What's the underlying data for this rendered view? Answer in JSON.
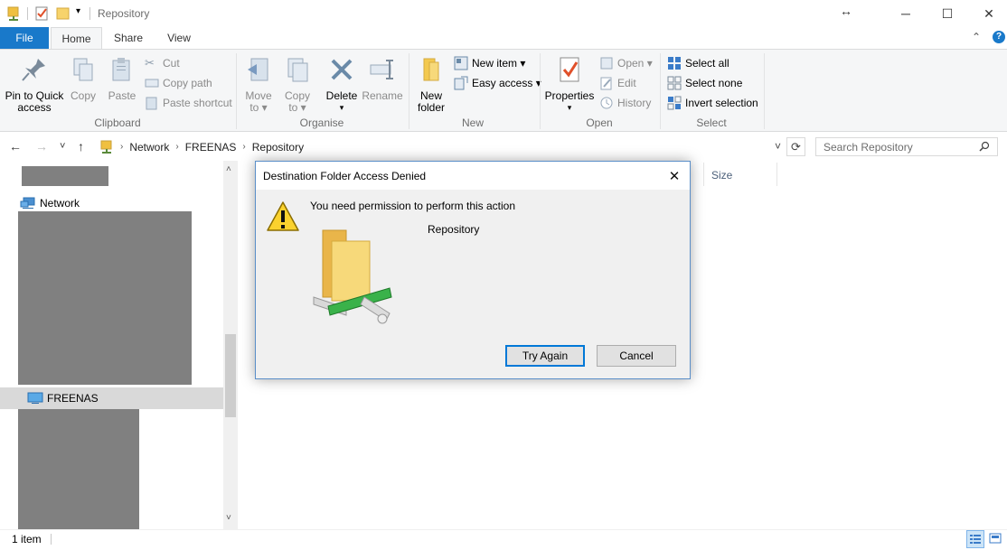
{
  "window": {
    "title": "Repository",
    "resize_glyph": "↔",
    "minimize": "─",
    "maximize": "☐",
    "close": "✕"
  },
  "ribbon_tabs": {
    "file": "File",
    "home": "Home",
    "share": "Share",
    "view": "View",
    "collapse": "⌃",
    "help": "?"
  },
  "ribbon": {
    "clipboard": {
      "group_label": "Clipboard",
      "pin_line1": "Pin to Quick",
      "pin_line2": "access",
      "copy": "Copy",
      "paste": "Paste",
      "cut": "Cut",
      "copy_path": "Copy path",
      "paste_shortcut": "Paste shortcut"
    },
    "organise": {
      "group_label": "Organise",
      "move_to_line1": "Move",
      "move_to_line2": "to ▾",
      "copy_to_line1": "Copy",
      "copy_to_line2": "to ▾",
      "delete": "Delete",
      "delete_arrow": "▾",
      "rename": "Rename"
    },
    "new": {
      "group_label": "New",
      "new_folder_line1": "New",
      "new_folder_line2": "folder",
      "new_item": "New item ▾",
      "easy_access": "Easy access ▾"
    },
    "open": {
      "group_label": "Open",
      "properties": "Properties",
      "properties_arrow": "▾",
      "open": "Open ▾",
      "edit": "Edit",
      "history": "History"
    },
    "select": {
      "group_label": "Select",
      "select_all": "Select all",
      "select_none": "Select none",
      "invert_selection": "Invert selection"
    }
  },
  "nav": {
    "back": "←",
    "forward": "→",
    "recent": "˅",
    "up": "↑",
    "breadcrumb": [
      "Network",
      "FREENAS",
      "Repository"
    ],
    "crumb_sep": "›",
    "dropdown": "˅",
    "refresh": "⟳",
    "search_placeholder": "Search Repository"
  },
  "navpane": {
    "network": "Network",
    "freenas": "FREENAS",
    "scroll_up": "˄",
    "scroll_down": "˅"
  },
  "content": {
    "size_column": "Size"
  },
  "status": {
    "item_count": "1 item"
  },
  "dialog": {
    "title": "Destination Folder Access Denied",
    "message": "You need permission to perform this action",
    "item_name": "Repository",
    "try_again": "Try Again",
    "cancel": "Cancel",
    "close": "✕"
  },
  "colors": {
    "file_tab": "#1979ca",
    "ribbon_bg": "#f5f6f7",
    "dialog_bg": "#f0f0f0",
    "dialog_border": "#5a8ec8",
    "primary_button_border": "#0078d7",
    "redaction": "#808080",
    "selected_row": "#d9d9d9"
  }
}
